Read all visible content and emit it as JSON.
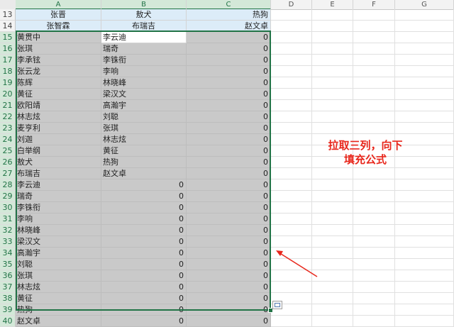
{
  "columns": [
    "A",
    "B",
    "C",
    "D",
    "E",
    "F",
    "G"
  ],
  "rows": [
    {
      "num": "13",
      "a": "张晋",
      "b": "敖犬",
      "c": "热狗",
      "style": "blue"
    },
    {
      "num": "14",
      "a": "张智霖",
      "b": "布瑞吉",
      "c": "赵文卓",
      "style": "blue"
    },
    {
      "num": "15",
      "a": "黄贯中",
      "b": "李云迪",
      "c": "0",
      "style": "white-b"
    },
    {
      "num": "16",
      "a": "张琪",
      "b": "瑞奇",
      "c": "0"
    },
    {
      "num": "17",
      "a": "李承铉",
      "b": "李铢衔",
      "c": "0"
    },
    {
      "num": "18",
      "a": "张云龙",
      "b": "李响",
      "c": "0"
    },
    {
      "num": "19",
      "a": "陈辉",
      "b": "林晓峰",
      "c": "0"
    },
    {
      "num": "20",
      "a": "黄征",
      "b": "梁汉文",
      "c": "0"
    },
    {
      "num": "21",
      "a": "欧阳靖",
      "b": "高瀚宇",
      "c": "0"
    },
    {
      "num": "22",
      "a": "林志炫",
      "b": "刘聪",
      "c": "0"
    },
    {
      "num": "23",
      "a": "麦亨利",
      "b": "张琪",
      "c": "0"
    },
    {
      "num": "24",
      "a": "刘迦",
      "b": "林志炫",
      "c": "0"
    },
    {
      "num": "25",
      "a": "白举纲",
      "b": "黄征",
      "c": "0"
    },
    {
      "num": "26",
      "a": "敖犬",
      "b": "热狗",
      "c": "0"
    },
    {
      "num": "27",
      "a": "布瑞吉",
      "b": "赵文卓",
      "c": "0"
    },
    {
      "num": "28",
      "a": "李云迪",
      "b": "0",
      "c": "0",
      "bnum": true
    },
    {
      "num": "29",
      "a": "瑞奇",
      "b": "0",
      "c": "0",
      "bnum": true
    },
    {
      "num": "30",
      "a": "李铢衔",
      "b": "0",
      "c": "0",
      "bnum": true
    },
    {
      "num": "31",
      "a": "李响",
      "b": "0",
      "c": "0",
      "bnum": true
    },
    {
      "num": "32",
      "a": "林晓峰",
      "b": "0",
      "c": "0",
      "bnum": true
    },
    {
      "num": "33",
      "a": "梁汉文",
      "b": "0",
      "c": "0",
      "bnum": true
    },
    {
      "num": "34",
      "a": "高瀚宇",
      "b": "0",
      "c": "0",
      "bnum": true
    },
    {
      "num": "35",
      "a": "刘聪",
      "b": "0",
      "c": "0",
      "bnum": true
    },
    {
      "num": "36",
      "a": "张琪",
      "b": "0",
      "c": "0",
      "bnum": true
    },
    {
      "num": "37",
      "a": "林志炫",
      "b": "0",
      "c": "0",
      "bnum": true
    },
    {
      "num": "38",
      "a": "黄征",
      "b": "0",
      "c": "0",
      "bnum": true
    },
    {
      "num": "39",
      "a": "热狗",
      "b": "0",
      "c": "0",
      "bnum": true
    },
    {
      "num": "40",
      "a": "赵文卓",
      "b": "0",
      "c": "0",
      "bnum": true
    }
  ],
  "annotation": {
    "line1": "拉取三列，向下",
    "line2": "填充公式"
  },
  "colors": {
    "selection": "#217346",
    "annotation": "#e8271c",
    "selected_fill": "#c9c9c9",
    "header_blue": "#dcecf8"
  },
  "icons": {
    "autofill_options": "paste-options-icon",
    "arrow": "arrow-icon"
  }
}
